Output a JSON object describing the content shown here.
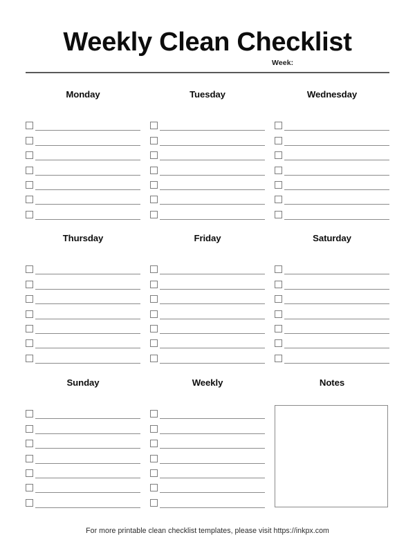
{
  "document": {
    "title": "Weekly Clean Checklist",
    "week_label": "Week:",
    "footer": "For more printable clean checklist templates, please visit https://inkpx.com"
  },
  "colors": {
    "text": "#0d0d0d",
    "rule": "#595959",
    "line": "#8a8a8a",
    "checkbox_border": "#7d7d7d",
    "background": "#ffffff"
  },
  "layout": {
    "rows_per_column": 7,
    "columns_per_block": 3,
    "blocks": 3
  },
  "blocks": [
    {
      "columns": [
        {
          "heading": "Monday",
          "kind": "checklist",
          "rows": 7
        },
        {
          "heading": "Tuesday",
          "kind": "checklist",
          "rows": 7
        },
        {
          "heading": "Wednesday",
          "kind": "checklist",
          "rows": 7
        }
      ]
    },
    {
      "columns": [
        {
          "heading": "Thursday",
          "kind": "checklist",
          "rows": 7
        },
        {
          "heading": "Friday",
          "kind": "checklist",
          "rows": 7
        },
        {
          "heading": "Saturday",
          "kind": "checklist",
          "rows": 7
        }
      ]
    },
    {
      "columns": [
        {
          "heading": "Sunday",
          "kind": "checklist",
          "rows": 7
        },
        {
          "heading": "Weekly",
          "kind": "checklist",
          "rows": 7
        },
        {
          "heading": "Notes",
          "kind": "notes",
          "rows": 0
        }
      ]
    }
  ]
}
